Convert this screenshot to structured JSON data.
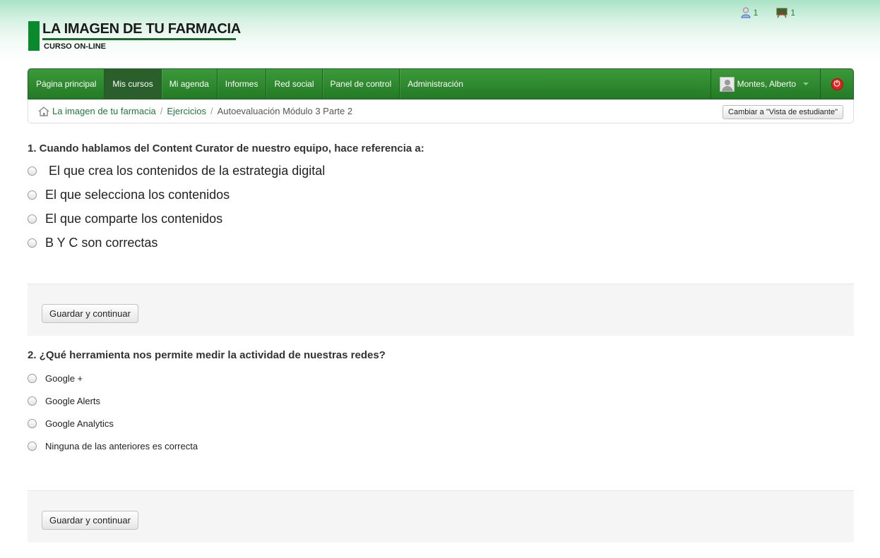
{
  "header": {
    "logo_title": "LA IMAGEN DE TU FARMACIA",
    "logo_subtitle": "CURSO ON-LINE",
    "users_online_count": "1",
    "messages_count": "1"
  },
  "nav": {
    "items": [
      {
        "label": "Página principal",
        "active": false
      },
      {
        "label": "Mis cursos",
        "active": true
      },
      {
        "label": "Mi agenda",
        "active": false
      },
      {
        "label": "Informes",
        "active": false
      },
      {
        "label": "Red social",
        "active": false
      },
      {
        "label": "Panel de control",
        "active": false
      },
      {
        "label": "Administración",
        "active": false
      }
    ],
    "user_name": "Montes, Alberto"
  },
  "breadcrumb": {
    "items": [
      "La imagen de tu farmacia",
      "Ejercicios",
      "Autoevaluación Módulo 3 Parte 2"
    ],
    "switch_button": "Cambiar a \"Vista de estudiante\""
  },
  "questions": [
    {
      "title": "1. Cuando hablamos del Content Curator de nuestro equipo, hace referencia a:",
      "options": [
        " El que crea los contenidos de la estrategia digital",
        "El que selecciona los contenidos",
        "El que comparte los contenidos",
        "B Y C son correctas"
      ],
      "save_label": "Guardar y continuar"
    },
    {
      "title": "2. ¿Qué herramienta nos permite medir la actividad de nuestras redes?",
      "options": [
        "Google +",
        "Google Alerts",
        "Google Analytics",
        "Ninguna de las anteriores es correcta"
      ],
      "save_label": "Guardar y continuar"
    }
  ],
  "colors": {
    "nav_green": "#237a25",
    "link_green": "#1c7a3a",
    "logo_green": "#0b8a2d",
    "power_red": "#e1231f"
  }
}
